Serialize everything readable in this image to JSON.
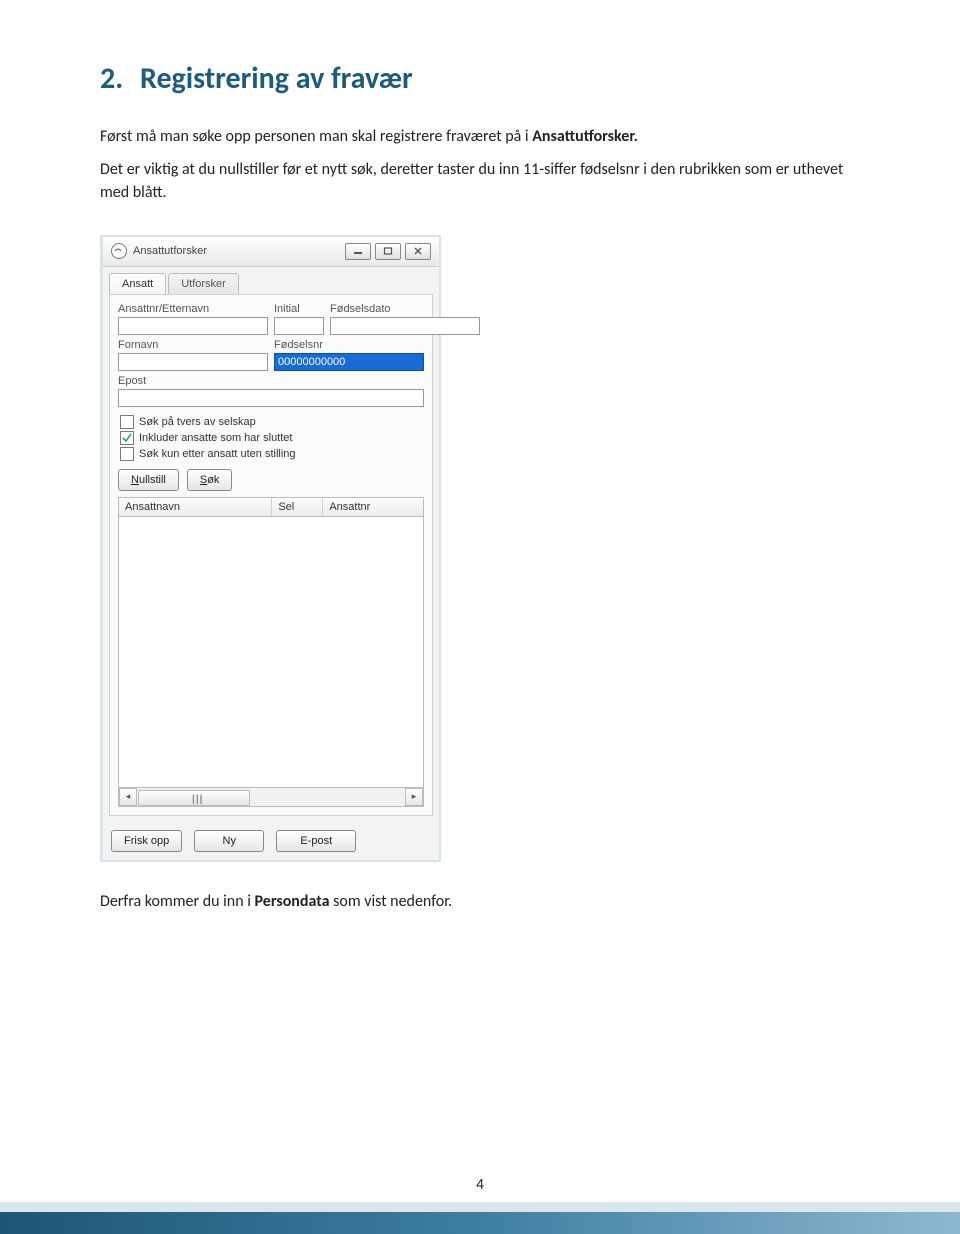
{
  "page_number": "4",
  "heading": {
    "number": "2.",
    "title": "Registrering av fravær"
  },
  "intro": {
    "line1_a": "Først må man søke opp personen man skal registrere fraværet på i ",
    "line1_b": "Ansattutforsker.",
    "line2": "Det er viktig at du nullstiller før et nytt søk, deretter taster du inn 11-siffer fødselsnr i den rubrikken som er uthevet med blått."
  },
  "window": {
    "title": "Ansattutforsker",
    "tabs": {
      "active": "Ansatt",
      "inactive": "Utforsker"
    },
    "fields": {
      "ansattnr_etternavn": "Ansattnr/Etternavn",
      "initial": "Initial",
      "fodselsdato": "Fødselsdato",
      "fornavn": "Fornavn",
      "fodselsnr": "Fødselsnr",
      "fodselsnr_value": "00000000000",
      "epost": "Epost"
    },
    "checkboxes": {
      "c1": "Søk på tvers av selskap",
      "c2": "Inkluder ansatte som har sluttet",
      "c3": "Søk kun etter ansatt uten stilling"
    },
    "buttons": {
      "nullstill_u": "N",
      "nullstill_rest": "ullstill",
      "sok_u": "S",
      "sok_rest": "øk",
      "friskopp": "Frisk opp",
      "ny": "Ny",
      "epost": "E-post"
    },
    "grid_cols": {
      "c1": "Ansattnavn",
      "c2": "Sel",
      "c3": "Ansattnr"
    }
  },
  "outro": {
    "a": "Derfra kommer du inn i ",
    "b": "Persondata",
    "c": " som vist nedenfor."
  }
}
